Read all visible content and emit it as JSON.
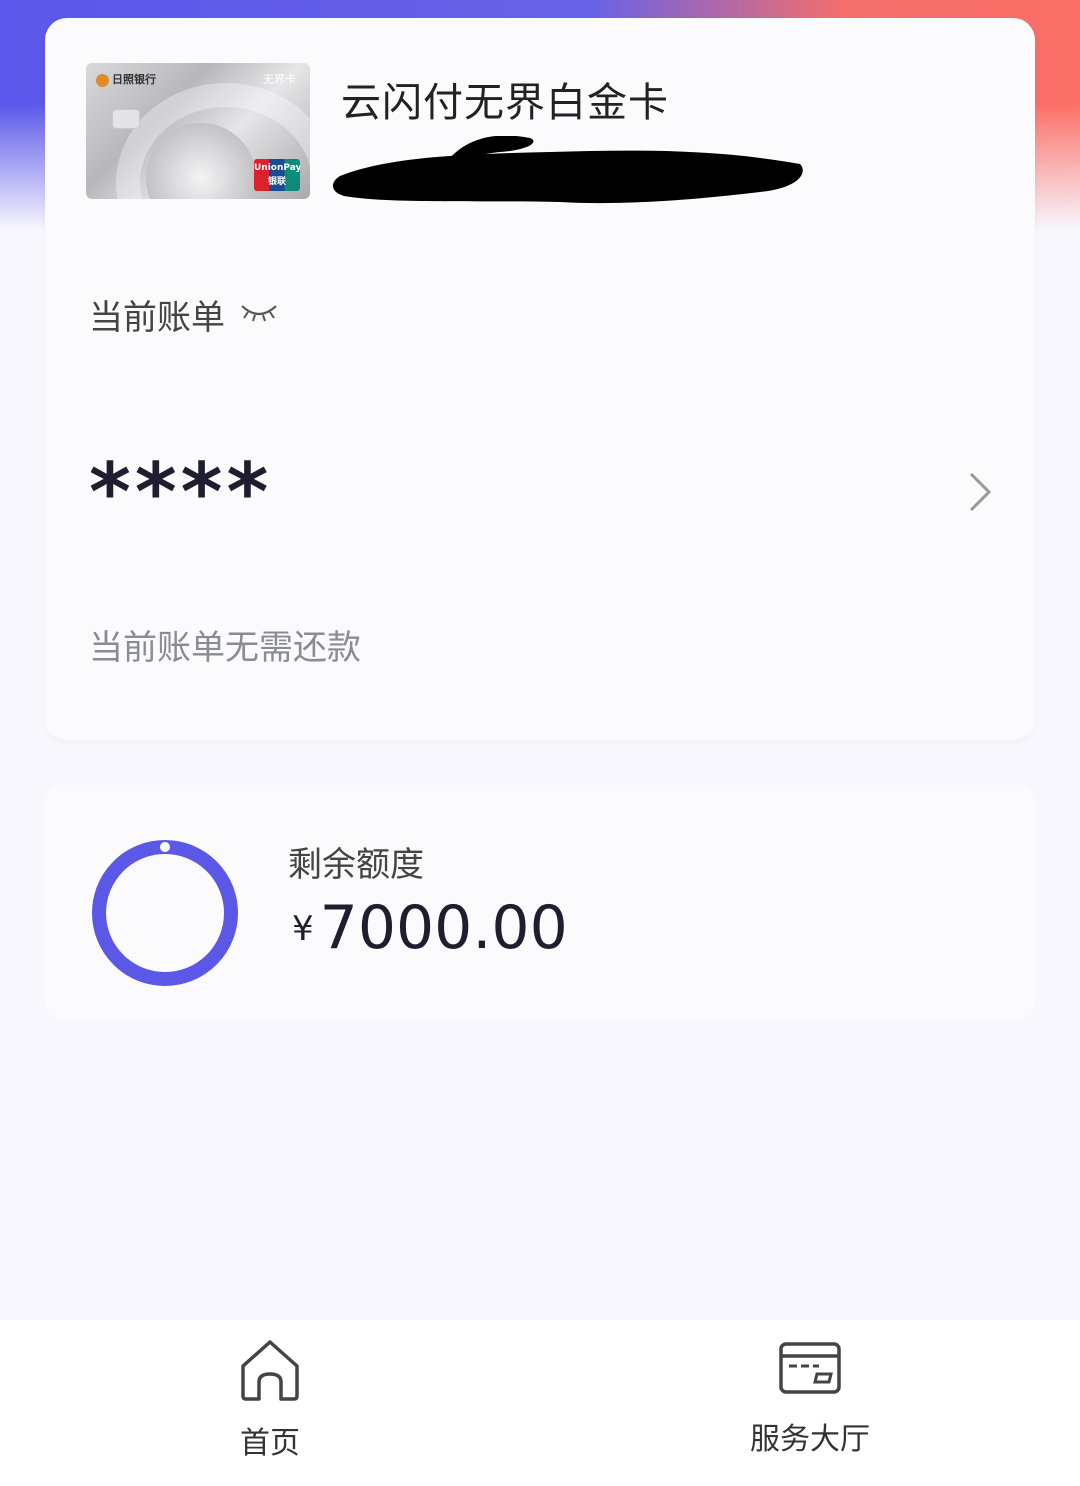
{
  "card": {
    "title": "云闪付无界白金卡",
    "thumbnail": {
      "bank_name": "日照银行",
      "product_mark": "无界卡",
      "network": "UnionPay 银联"
    }
  },
  "bill": {
    "label": "当前账单",
    "amount": "****",
    "note": "当前账单无需还款",
    "visibility_icon": "eye-closed-icon"
  },
  "credit": {
    "label": "剩余额度",
    "currency": "¥",
    "amount": "7000.00"
  },
  "tabbar": {
    "items": [
      {
        "label": "首页",
        "icon": "home-icon"
      },
      {
        "label": "服务大厅",
        "icon": "service-card-icon"
      }
    ]
  },
  "colors": {
    "accent": "#5b58e8",
    "header_right": "#fb6f66",
    "text_primary": "#1e1e2e",
    "text_secondary": "#8b8b94"
  }
}
